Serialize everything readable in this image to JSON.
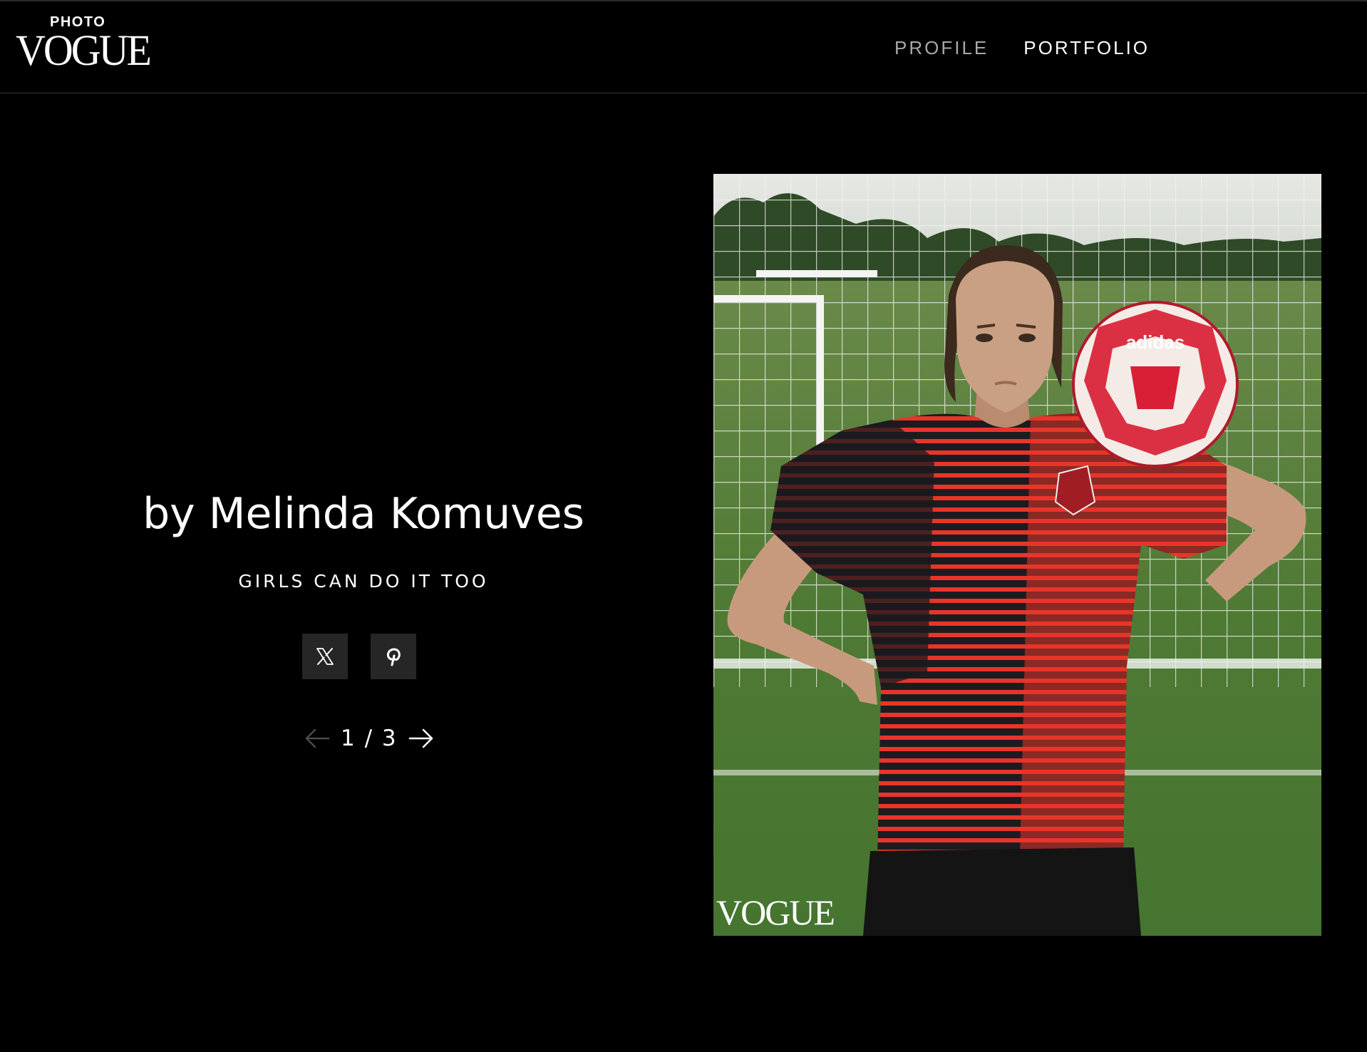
{
  "header": {
    "logo_small": "PHOTO",
    "logo_main": "VOGUE",
    "nav": [
      {
        "label": "PROFILE",
        "active": false
      },
      {
        "label": "PORTFOLIO",
        "active": true
      }
    ]
  },
  "main": {
    "photographer": "by Melinda Komuves",
    "series_title": "GIRLS CAN DO IT TOO",
    "share_icons": [
      "x-icon",
      "pinterest-icon"
    ],
    "pager": {
      "count": "1 / 3",
      "prev_icon": "arrow-left-icon",
      "next_icon": "arrow-right-icon"
    }
  },
  "photo": {
    "watermark": "VOGUE",
    "ball_brand": "adidas"
  },
  "colors": {
    "background": "#000000",
    "nav_inactive": "#a8a8a8",
    "share_button": "#262626",
    "jersey_red": "#e8352a",
    "grass": "#5a7a3c"
  }
}
